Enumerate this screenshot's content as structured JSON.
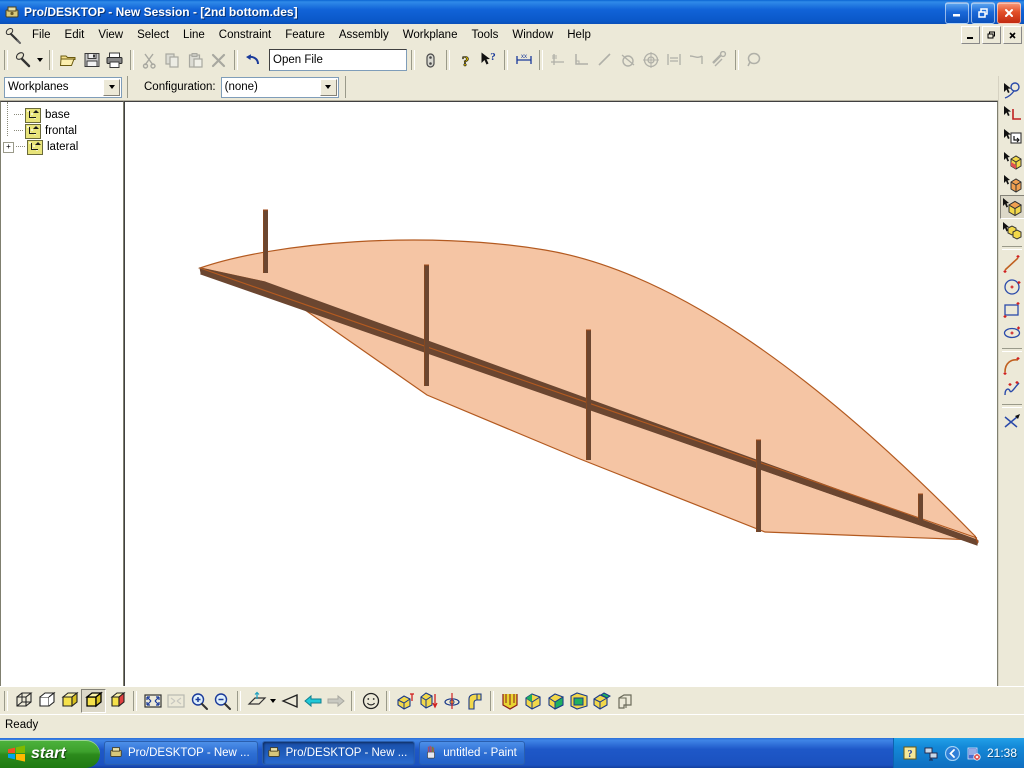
{
  "window": {
    "title": "Pro/DESKTOP - New Session - [2nd bottom.des]",
    "app_icon": "prodesktop-icon",
    "controls": {
      "minimize": "_",
      "maximize": "❐",
      "close": "✕"
    },
    "mdi_controls": {
      "minimize": "_",
      "restore": "❐",
      "close": "✕"
    }
  },
  "menubar": {
    "icon": "pencil-icon",
    "items": [
      {
        "label": "File"
      },
      {
        "label": "Edit"
      },
      {
        "label": "View"
      },
      {
        "label": "Select"
      },
      {
        "label": "Line"
      },
      {
        "label": "Constraint"
      },
      {
        "label": "Feature"
      },
      {
        "label": "Assembly"
      },
      {
        "label": "Workplane"
      },
      {
        "label": "Tools"
      },
      {
        "label": "Window"
      },
      {
        "label": "Help"
      }
    ]
  },
  "toolbar": {
    "file_box_value": "Open File",
    "buttons": [
      {
        "name": "new-design-button",
        "icon": "pencil-icon"
      },
      {
        "name": "new-design-dropdown",
        "icon": "chevron-down-icon"
      },
      {
        "name": "open-button",
        "icon": "folder-open-icon"
      },
      {
        "name": "save-button",
        "icon": "floppy-disk-icon"
      },
      {
        "name": "print-button",
        "icon": "printer-icon"
      },
      {
        "name": "cut-button",
        "icon": "scissors-icon"
      },
      {
        "name": "copy-button",
        "icon": "copy-icon"
      },
      {
        "name": "paste-button",
        "icon": "clipboard-icon"
      },
      {
        "name": "delete-button",
        "icon": "x-delete-icon"
      },
      {
        "name": "undo-button",
        "icon": "undo-arrow-icon"
      },
      {
        "name": "properties-button",
        "icon": "properties-icon"
      },
      {
        "name": "help-button",
        "icon": "question-mark-icon"
      },
      {
        "name": "context-help-button",
        "icon": "arrow-question-icon"
      },
      {
        "name": "dimension-button",
        "icon": "dimension-icon"
      },
      {
        "name": "perpendicular-constraint-button",
        "icon": "perpendicular-icon"
      },
      {
        "name": "angle-constraint-button",
        "icon": "angle-icon"
      },
      {
        "name": "line-constraint-button",
        "icon": "line-icon"
      },
      {
        "name": "tangent-constraint-button",
        "icon": "tangent-icon"
      },
      {
        "name": "concentric-constraint-button",
        "icon": "concentric-icon"
      },
      {
        "name": "equal-constraint-button",
        "icon": "equal-icon"
      },
      {
        "name": "parallel-constraint-button",
        "icon": "parallel-icon"
      },
      {
        "name": "fix-constraint-button",
        "icon": "fix-icon"
      },
      {
        "name": "inspect-button",
        "icon": "magnifier-icon"
      }
    ]
  },
  "configbar": {
    "workplanes_selector_value": "Workplanes",
    "configuration_label": "Configuration:",
    "configuration_value": "(none)"
  },
  "tree": {
    "items": [
      {
        "label": "base",
        "icon": "workplane-icon",
        "expandable": false
      },
      {
        "label": "frontal",
        "icon": "workplane-icon",
        "expandable": false
      },
      {
        "label": "lateral",
        "icon": "workplane-icon",
        "expandable": true,
        "expander": "+"
      }
    ]
  },
  "right_toolbar": {
    "buttons": [
      {
        "name": "select-feature-tool",
        "icon": "arrow-circle-icon",
        "selected": false
      },
      {
        "name": "select-edge-tool",
        "icon": "arrow-corner-icon",
        "selected": false
      },
      {
        "name": "select-workplane-tool",
        "icon": "arrow-workplane-icon",
        "selected": false
      },
      {
        "name": "select-face-tool",
        "icon": "arrow-cube-face-icon",
        "selected": false
      },
      {
        "name": "select-solid-tool",
        "icon": "arrow-cube-solid-icon",
        "selected": false
      },
      {
        "name": "select-part-tool",
        "icon": "arrow-cube-part-icon",
        "selected": true
      },
      {
        "name": "select-assembly-tool",
        "icon": "arrow-two-cubes-icon",
        "selected": false
      },
      {
        "name": "line-tool",
        "icon": "line-draw-icon",
        "selected": false
      },
      {
        "name": "circle-tool",
        "icon": "circle-draw-icon",
        "selected": false
      },
      {
        "name": "rectangle-tool",
        "icon": "rectangle-draw-icon",
        "selected": false
      },
      {
        "name": "ellipse-tool",
        "icon": "ellipse-draw-icon",
        "selected": false
      },
      {
        "name": "arc-tool",
        "icon": "arc-draw-icon",
        "selected": false
      },
      {
        "name": "spline-tool",
        "icon": "spline-draw-icon",
        "selected": false
      },
      {
        "name": "trim-tool",
        "icon": "trim-scissors-icon",
        "selected": false
      }
    ]
  },
  "bottom_toolbar": {
    "buttons": [
      {
        "name": "wireframe-view-button",
        "icon": "wireframe-cube-icon",
        "selected": false
      },
      {
        "name": "hidden-line-view-button",
        "icon": "hidden-line-cube-icon",
        "selected": false
      },
      {
        "name": "shaded-view-button",
        "icon": "shaded-cube-icon",
        "selected": false
      },
      {
        "name": "shaded-edges-view-button",
        "icon": "shaded-edges-cube-icon",
        "selected": true
      },
      {
        "name": "transparent-view-button",
        "icon": "transparent-cube-icon",
        "selected": false
      },
      {
        "name": "zoom-fit-button",
        "icon": "zoom-fit-icon",
        "selected": false
      },
      {
        "name": "zoom-selection-button",
        "icon": "zoom-selection-icon",
        "selected": false
      },
      {
        "name": "zoom-in-button",
        "icon": "zoom-in-icon",
        "selected": false
      },
      {
        "name": "zoom-out-button",
        "icon": "zoom-out-icon",
        "selected": false
      },
      {
        "name": "view-orientation-button",
        "icon": "workplane-view-icon",
        "selected": false
      },
      {
        "name": "view-orientation-dropdown",
        "icon": "chevron-down-icon",
        "selected": false
      },
      {
        "name": "perspective-button",
        "icon": "eye-cone-icon",
        "selected": false
      },
      {
        "name": "previous-view-button",
        "icon": "left-arrow-icon",
        "selected": false
      },
      {
        "name": "next-view-button",
        "icon": "right-arrow-icon",
        "selected": false
      },
      {
        "name": "render-button",
        "icon": "smiley-face-icon",
        "selected": false
      },
      {
        "name": "extrude-feature-button",
        "icon": "extrude-icon",
        "selected": false
      },
      {
        "name": "project-feature-button",
        "icon": "project-icon",
        "selected": false
      },
      {
        "name": "revolve-feature-button",
        "icon": "revolve-icon",
        "selected": false
      },
      {
        "name": "sweep-feature-button",
        "icon": "sweep-icon",
        "selected": false
      },
      {
        "name": "loft-feature-button",
        "icon": "loft-icon",
        "selected": false
      },
      {
        "name": "round-feature-button",
        "icon": "round-edge-icon",
        "selected": false
      },
      {
        "name": "chamfer-feature-button",
        "icon": "chamfer-edge-icon",
        "selected": false
      },
      {
        "name": "shell-feature-button",
        "icon": "shell-icon",
        "selected": false
      },
      {
        "name": "draft-feature-button",
        "icon": "draft-icon",
        "selected": false
      },
      {
        "name": "copy-feature-button",
        "icon": "copy-feature-icon",
        "selected": false
      }
    ]
  },
  "statusbar": {
    "text": "Ready"
  },
  "viewport": {
    "model_name": "2nd bottom",
    "face_color": "#f5c5a4",
    "edge_color": "#a34a18",
    "shadow_edge_color": "#6b4630",
    "background": "#ffffff",
    "description": "Shaded tapered wing-shaped solid with five vertical slot cuts along the lower edge"
  },
  "taskbar": {
    "start_label": "start",
    "items": [
      {
        "label": "Pro/DESKTOP - New ...",
        "icon": "prodesktop-icon",
        "active": false
      },
      {
        "label": "Pro/DESKTOP - New ...",
        "icon": "prodesktop-icon",
        "active": true
      },
      {
        "label": "untitled - Paint",
        "icon": "paint-icon",
        "active": false
      }
    ],
    "tray": {
      "icons": [
        "help-tray-icon",
        "network-tray-icon",
        "show-hidden-chevron-icon",
        "volume-tray-icon"
      ],
      "clock": "21:38"
    }
  }
}
